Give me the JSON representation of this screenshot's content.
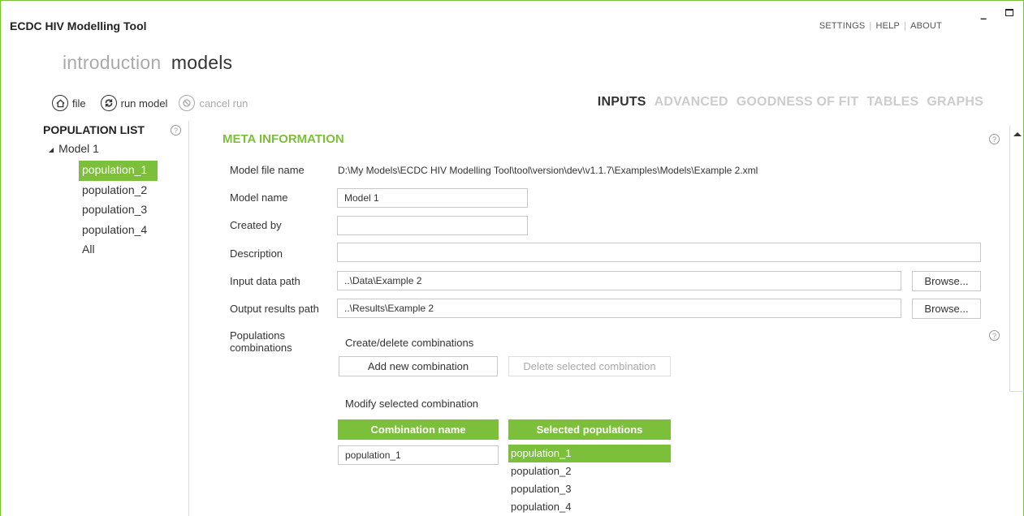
{
  "app": {
    "title": "ECDC HIV Modelling Tool"
  },
  "topnav": {
    "settings": "SETTINGS",
    "help": "HELP",
    "about": "ABOUT"
  },
  "mainnav": {
    "introduction": "introduction",
    "models": "models"
  },
  "toolbar": {
    "file": "file",
    "run_model": "run model",
    "cancel_run": "cancel run"
  },
  "tabs": {
    "inputs": "INPUTS",
    "advanced": "ADVANCED",
    "goodness": "GOODNESS OF FIT",
    "tables": "TABLES",
    "graphs": "GRAPHS"
  },
  "population_list": {
    "title": "POPULATION LIST",
    "root": "Model 1",
    "items": [
      "population_1",
      "population_2",
      "population_3",
      "population_4",
      "All"
    ]
  },
  "meta": {
    "title": "META INFORMATION",
    "model_file_label": "Model file name",
    "model_file_value": "D:\\My Models\\ECDC HIV Modelling Tool\\tool\\version\\dev\\v1.1.7\\Examples\\Models\\Example 2.xml",
    "model_name_label": "Model name",
    "model_name_value": "Model 1",
    "created_by_label": "Created by",
    "created_by_value": "",
    "description_label": "Description",
    "description_value": "",
    "input_path_label": "Input data path",
    "input_path_value": "..\\Data\\Example 2",
    "output_path_label": "Output results path",
    "output_path_value": "..\\Results\\Example 2",
    "browse": "Browse...",
    "pop_comb_label_1": "Populations",
    "pop_comb_label_2": "combinations",
    "create_delete": "Create/delete combinations",
    "add_new": "Add new combination",
    "delete_selected": "Delete selected combination",
    "modify_selected": "Modify selected combination",
    "combination_name_header": "Combination name",
    "selected_populations_header": "Selected populations",
    "combination_name_value": "population_1",
    "selected_populations": [
      "population_1",
      "population_2",
      "population_3",
      "population_4"
    ]
  },
  "colors": {
    "accent": "#7cbf3a"
  }
}
